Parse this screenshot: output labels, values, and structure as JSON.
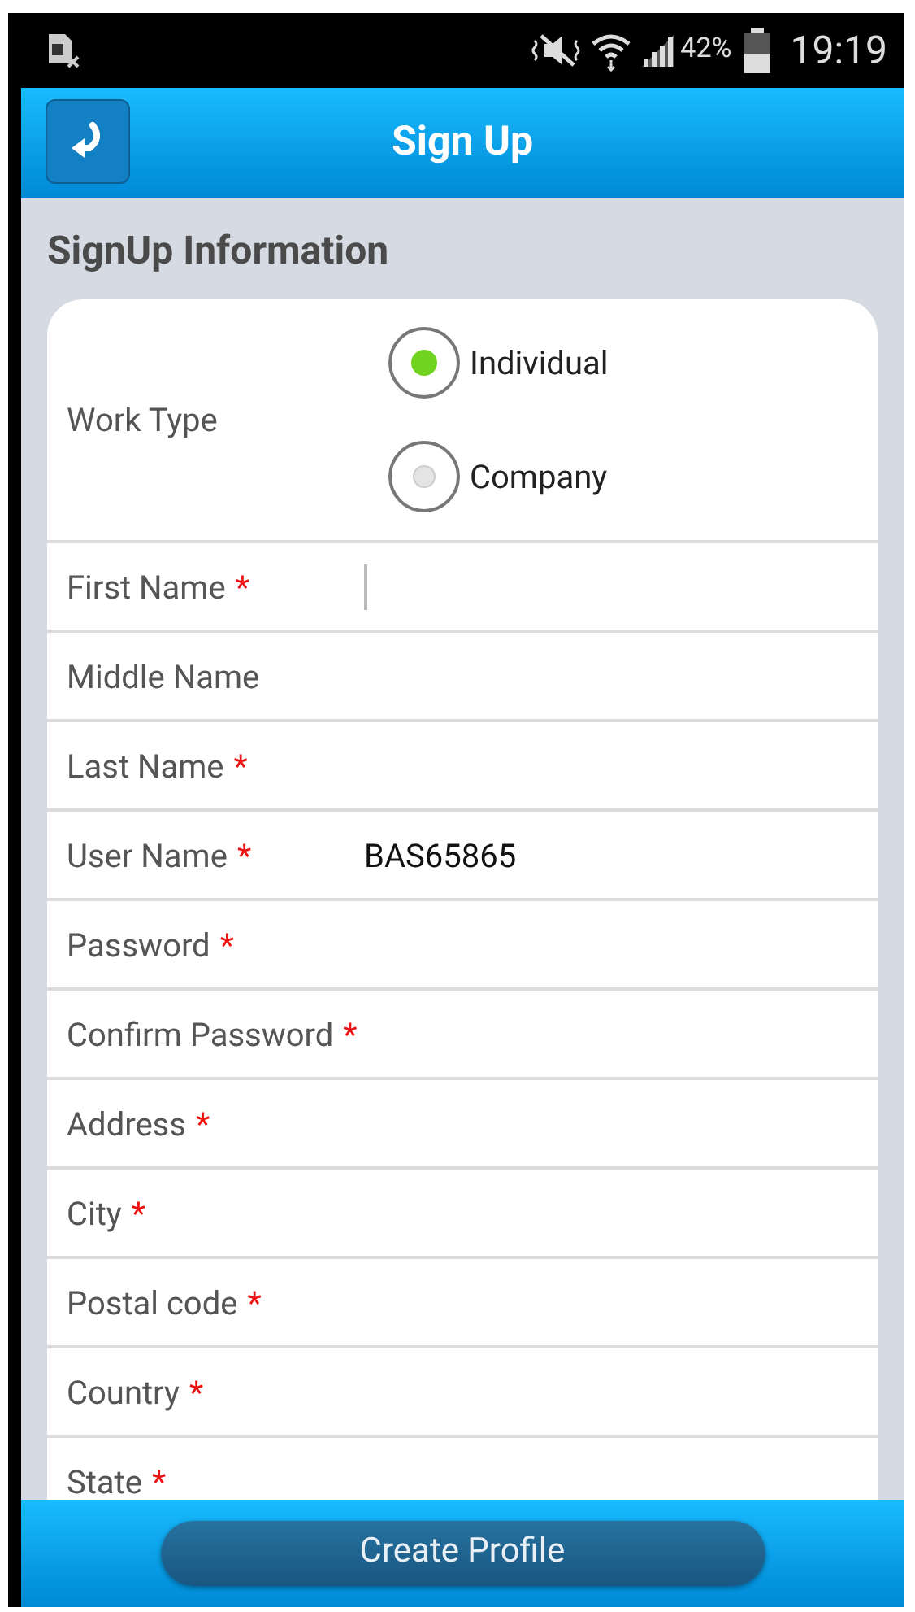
{
  "status_bar": {
    "battery_text": "42%",
    "time": "19:19"
  },
  "app_bar": {
    "title": "Sign Up"
  },
  "section_title": "SignUp Information",
  "work_type": {
    "label": "Work Type",
    "options": [
      {
        "label": "Individual",
        "selected": true
      },
      {
        "label": "Company",
        "selected": false
      }
    ]
  },
  "fields": [
    {
      "label": "First Name",
      "required_mark": "*",
      "focused": true
    },
    {
      "label": "Middle Name",
      "focused": false
    },
    {
      "label": "Last Name",
      "required_mark": "*",
      "focused": false
    },
    {
      "label": "User Name",
      "required_mark": "*",
      "value": "BAS65865",
      "focused": false
    },
    {
      "label": "Password",
      "required_mark": "*",
      "focused": false
    },
    {
      "label": "Confirm Password",
      "required_mark": "*",
      "focused": false
    },
    {
      "label": "Address",
      "required_mark": "*",
      "focused": false
    },
    {
      "label": "City",
      "required_mark": "*",
      "focused": false
    },
    {
      "label": "Postal code",
      "required_mark": "*",
      "focused": false
    },
    {
      "label": "Country",
      "required_mark": "*",
      "focused": false
    },
    {
      "label": "State",
      "required_mark": "*",
      "focused": false
    }
  ],
  "primary_button": "Create Profile"
}
